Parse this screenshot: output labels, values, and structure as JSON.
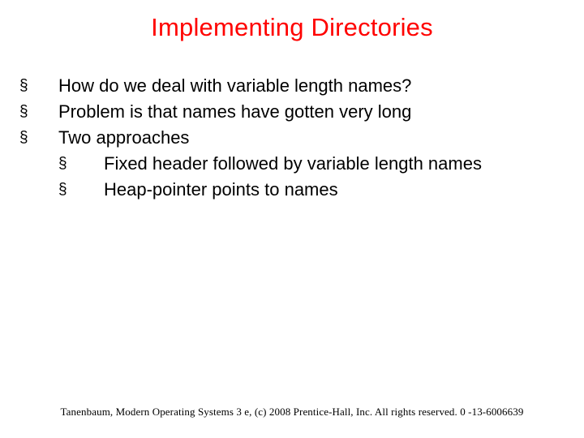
{
  "title": "Implementing Directories",
  "glyph": "§",
  "bullets": [
    "How do we deal with variable length names?",
    "Problem is that names have gotten very long",
    "Two approaches"
  ],
  "subbullets": [
    "Fixed header followed by variable length names",
    "Heap-pointer points to names"
  ],
  "footer": "Tanenbaum, Modern Operating Systems 3 e, (c) 2008 Prentice-Hall, Inc. All rights reserved. 0 -13-6006639"
}
